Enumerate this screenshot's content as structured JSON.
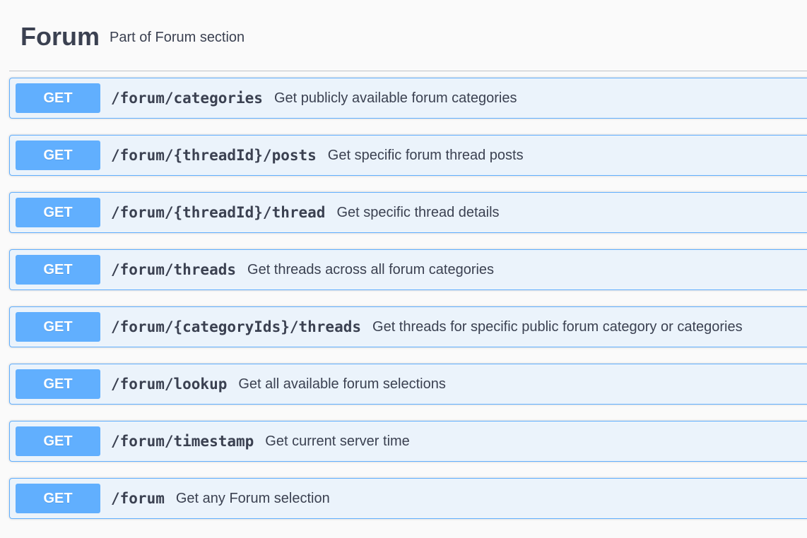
{
  "section": {
    "title": "Forum",
    "subtitle": "Part of Forum section"
  },
  "colors": {
    "get_method": "#61affe",
    "get_background": "#ebf3fb",
    "text": "#3b4151"
  },
  "operations": [
    {
      "method": "GET",
      "path": "/forum/categories",
      "summary": "Get publicly available forum categories"
    },
    {
      "method": "GET",
      "path": "/forum/{threadId}/posts",
      "summary": "Get specific forum thread posts"
    },
    {
      "method": "GET",
      "path": "/forum/{threadId}/thread",
      "summary": "Get specific thread details"
    },
    {
      "method": "GET",
      "path": "/forum/threads",
      "summary": "Get threads across all forum categories"
    },
    {
      "method": "GET",
      "path": "/forum/{categoryIds}/threads",
      "summary": "Get threads for specific public forum category or categories"
    },
    {
      "method": "GET",
      "path": "/forum/lookup",
      "summary": "Get all available forum selections"
    },
    {
      "method": "GET",
      "path": "/forum/timestamp",
      "summary": "Get current server time"
    },
    {
      "method": "GET",
      "path": "/forum",
      "summary": "Get any Forum selection"
    }
  ]
}
